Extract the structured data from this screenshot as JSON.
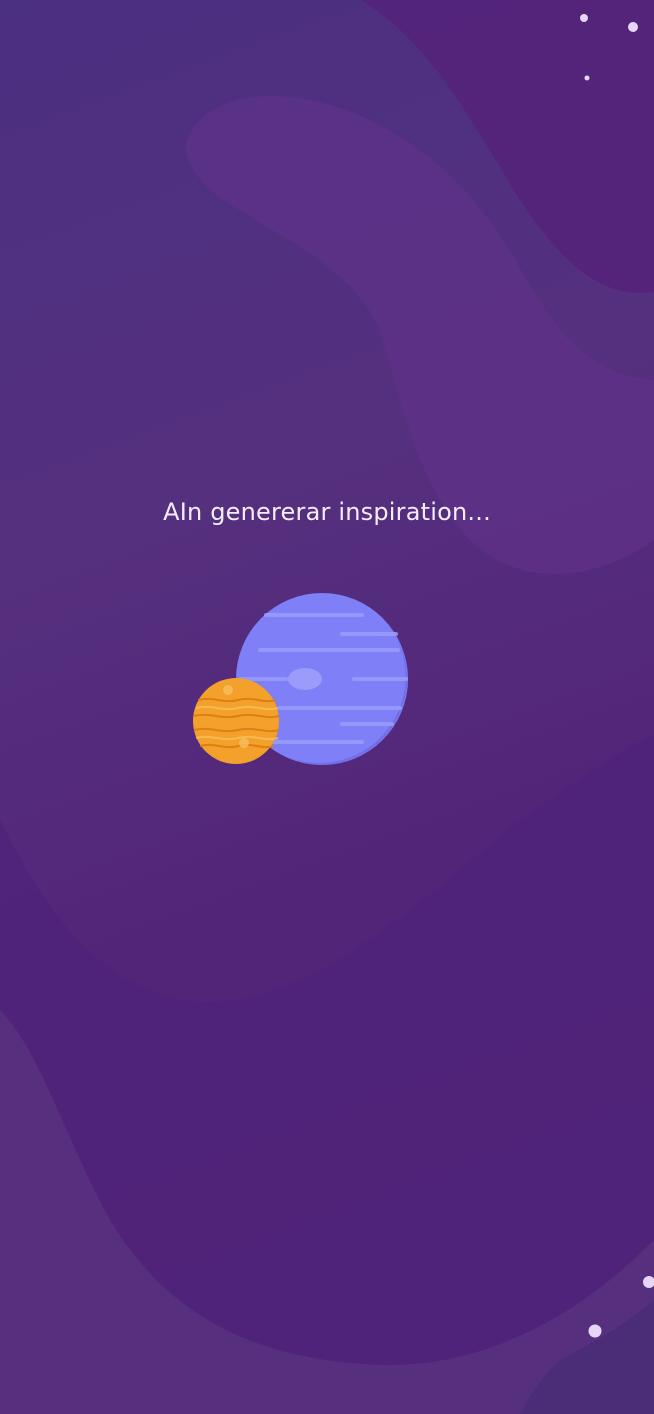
{
  "loading": {
    "message": "AIn genererar inspiration..."
  },
  "illustration": {
    "icons": [
      "planet-icon",
      "small-planet-icon",
      "star-icon"
    ]
  },
  "colors": {
    "background": "#4b2f80",
    "large_planet": "#7f7ff7",
    "small_planet": "#f3a12a",
    "text": "#f4eefc"
  }
}
